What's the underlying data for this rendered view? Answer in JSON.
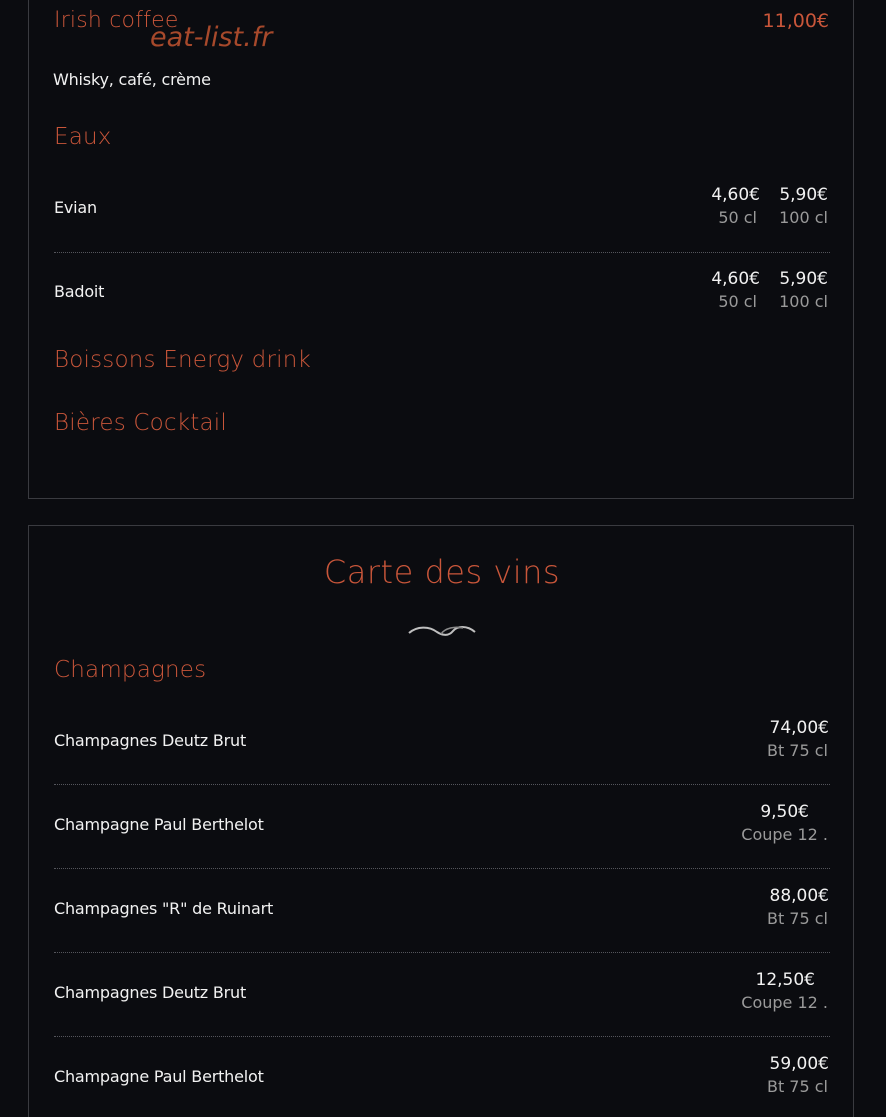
{
  "watermark": "eat-list.fr",
  "top": {
    "irish": {
      "name": "Irish coffee",
      "price": "11,00€",
      "desc": "Whisky, café, crème"
    },
    "eaux_title": "Eaux",
    "waters": [
      {
        "name": "Evian",
        "price1": "4,60€",
        "size1": "50 cl",
        "price2": "5,90€",
        "size2": "100 cl"
      },
      {
        "name": "Badoit",
        "price1": "4,60€",
        "size1": "50 cl",
        "price2": "5,90€",
        "size2": "100 cl"
      }
    ],
    "energy_title": "Boissons Energy drink",
    "bieres_title": "Bières Cocktail"
  },
  "wines": {
    "title": "Carte des vins",
    "champagnes_title": "Champagnes",
    "items": [
      {
        "name": "Champagnes Deutz Brut",
        "price": "74,00€",
        "size": "Bt 75 cl"
      },
      {
        "name": "Champagne Paul Berthelot",
        "price": "9,50€",
        "size": "Coupe 12 ."
      },
      {
        "name": "Champagnes \"R\" de Ruinart",
        "price": "88,00€",
        "size": "Bt 75 cl"
      },
      {
        "name": "Champagnes Deutz Brut",
        "price": "12,50€",
        "size": "Coupe 12 ."
      },
      {
        "name": "Champagne Paul Berthelot",
        "price": "59,00€",
        "size": "Bt 75 cl"
      }
    ]
  },
  "colors": {
    "accent": "#c9563a",
    "background": "#0b0c10",
    "text": "#f2f2f2",
    "muted": "#9a9a9a"
  }
}
